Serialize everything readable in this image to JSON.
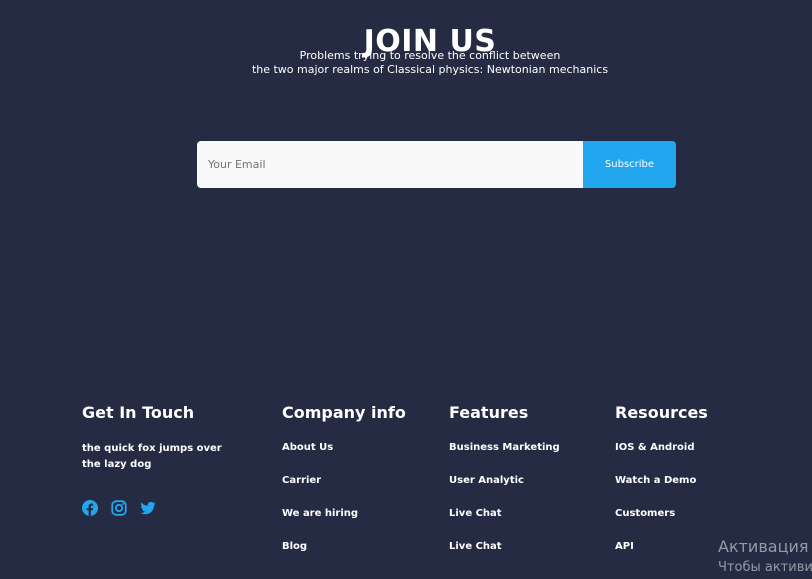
{
  "join": {
    "title": "JOIN US",
    "subtitle_line1": "Problems trying to resolve the conflict between",
    "subtitle_line2": "the two major realms of Classical physics: Newtonian mechanics"
  },
  "subscribe": {
    "placeholder": "Your Email",
    "button_label": "Subscribe"
  },
  "footer": {
    "get_in_touch": {
      "title": "Get In Touch",
      "text": "the quick fox jumps over the lazy dog",
      "social_icons": [
        "facebook-icon",
        "instagram-icon",
        "twitter-icon"
      ]
    },
    "company_info": {
      "title": "Company info",
      "links": [
        "About Us",
        "Carrier",
        "We are hiring",
        "Blog"
      ]
    },
    "features": {
      "title": "Features",
      "links": [
        "Business Marketing",
        "User Analytic",
        "Live Chat",
        "Live Chat"
      ]
    },
    "resources": {
      "title": "Resources",
      "links": [
        "IOS & Android",
        "Watch a Demo",
        "Customers",
        "API"
      ]
    }
  },
  "watermark": {
    "line1": "Активация",
    "line2": "Чтобы активи"
  },
  "colors": {
    "background": "#252B42",
    "accent": "#23A6F0",
    "input_bg": "#F9F9F9",
    "text": "#FFFFFF"
  }
}
